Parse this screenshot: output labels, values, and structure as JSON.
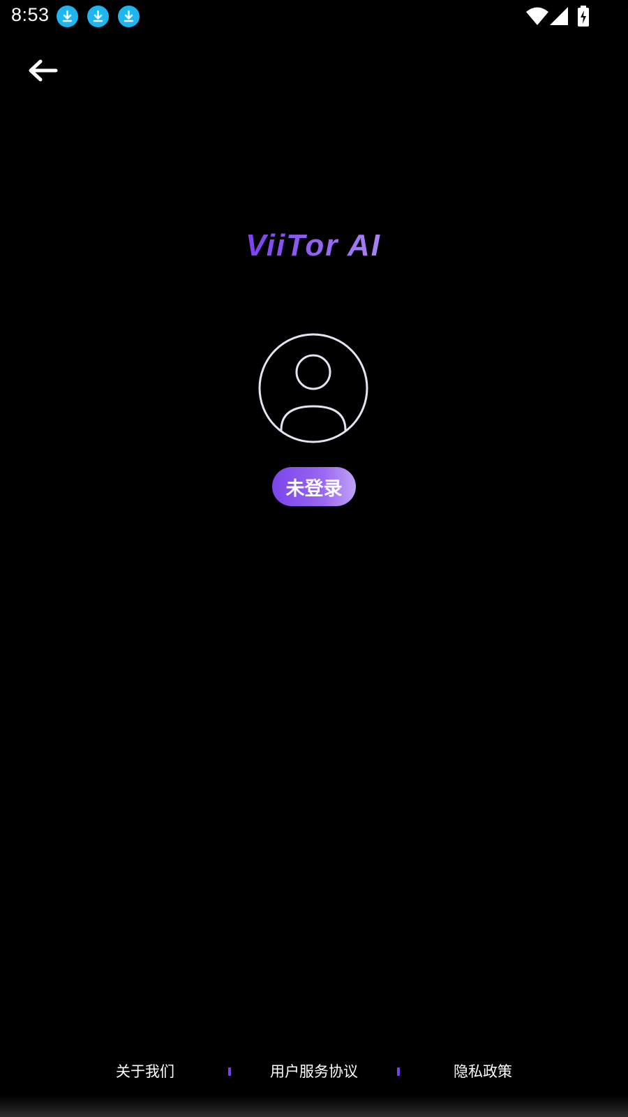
{
  "status_bar": {
    "time": "8:53",
    "notification_icons": [
      "download-icon",
      "download-icon",
      "download-icon"
    ],
    "system_icons": [
      "wifi-icon",
      "cellular-signal-icon",
      "battery-charging-icon"
    ]
  },
  "header": {
    "back_icon": "arrow-left-icon"
  },
  "logo": {
    "text": "ViiTor AI"
  },
  "profile": {
    "avatar_icon": "user-avatar-icon",
    "login_status_label": "未登录"
  },
  "footer": {
    "links": [
      {
        "label": "关于我们"
      },
      {
        "label": "用户服务协议"
      },
      {
        "label": "隐私政策"
      }
    ]
  },
  "colors": {
    "background": "#000000",
    "accent": "#7b3ff0",
    "download_badge": "#1fb6f0"
  }
}
